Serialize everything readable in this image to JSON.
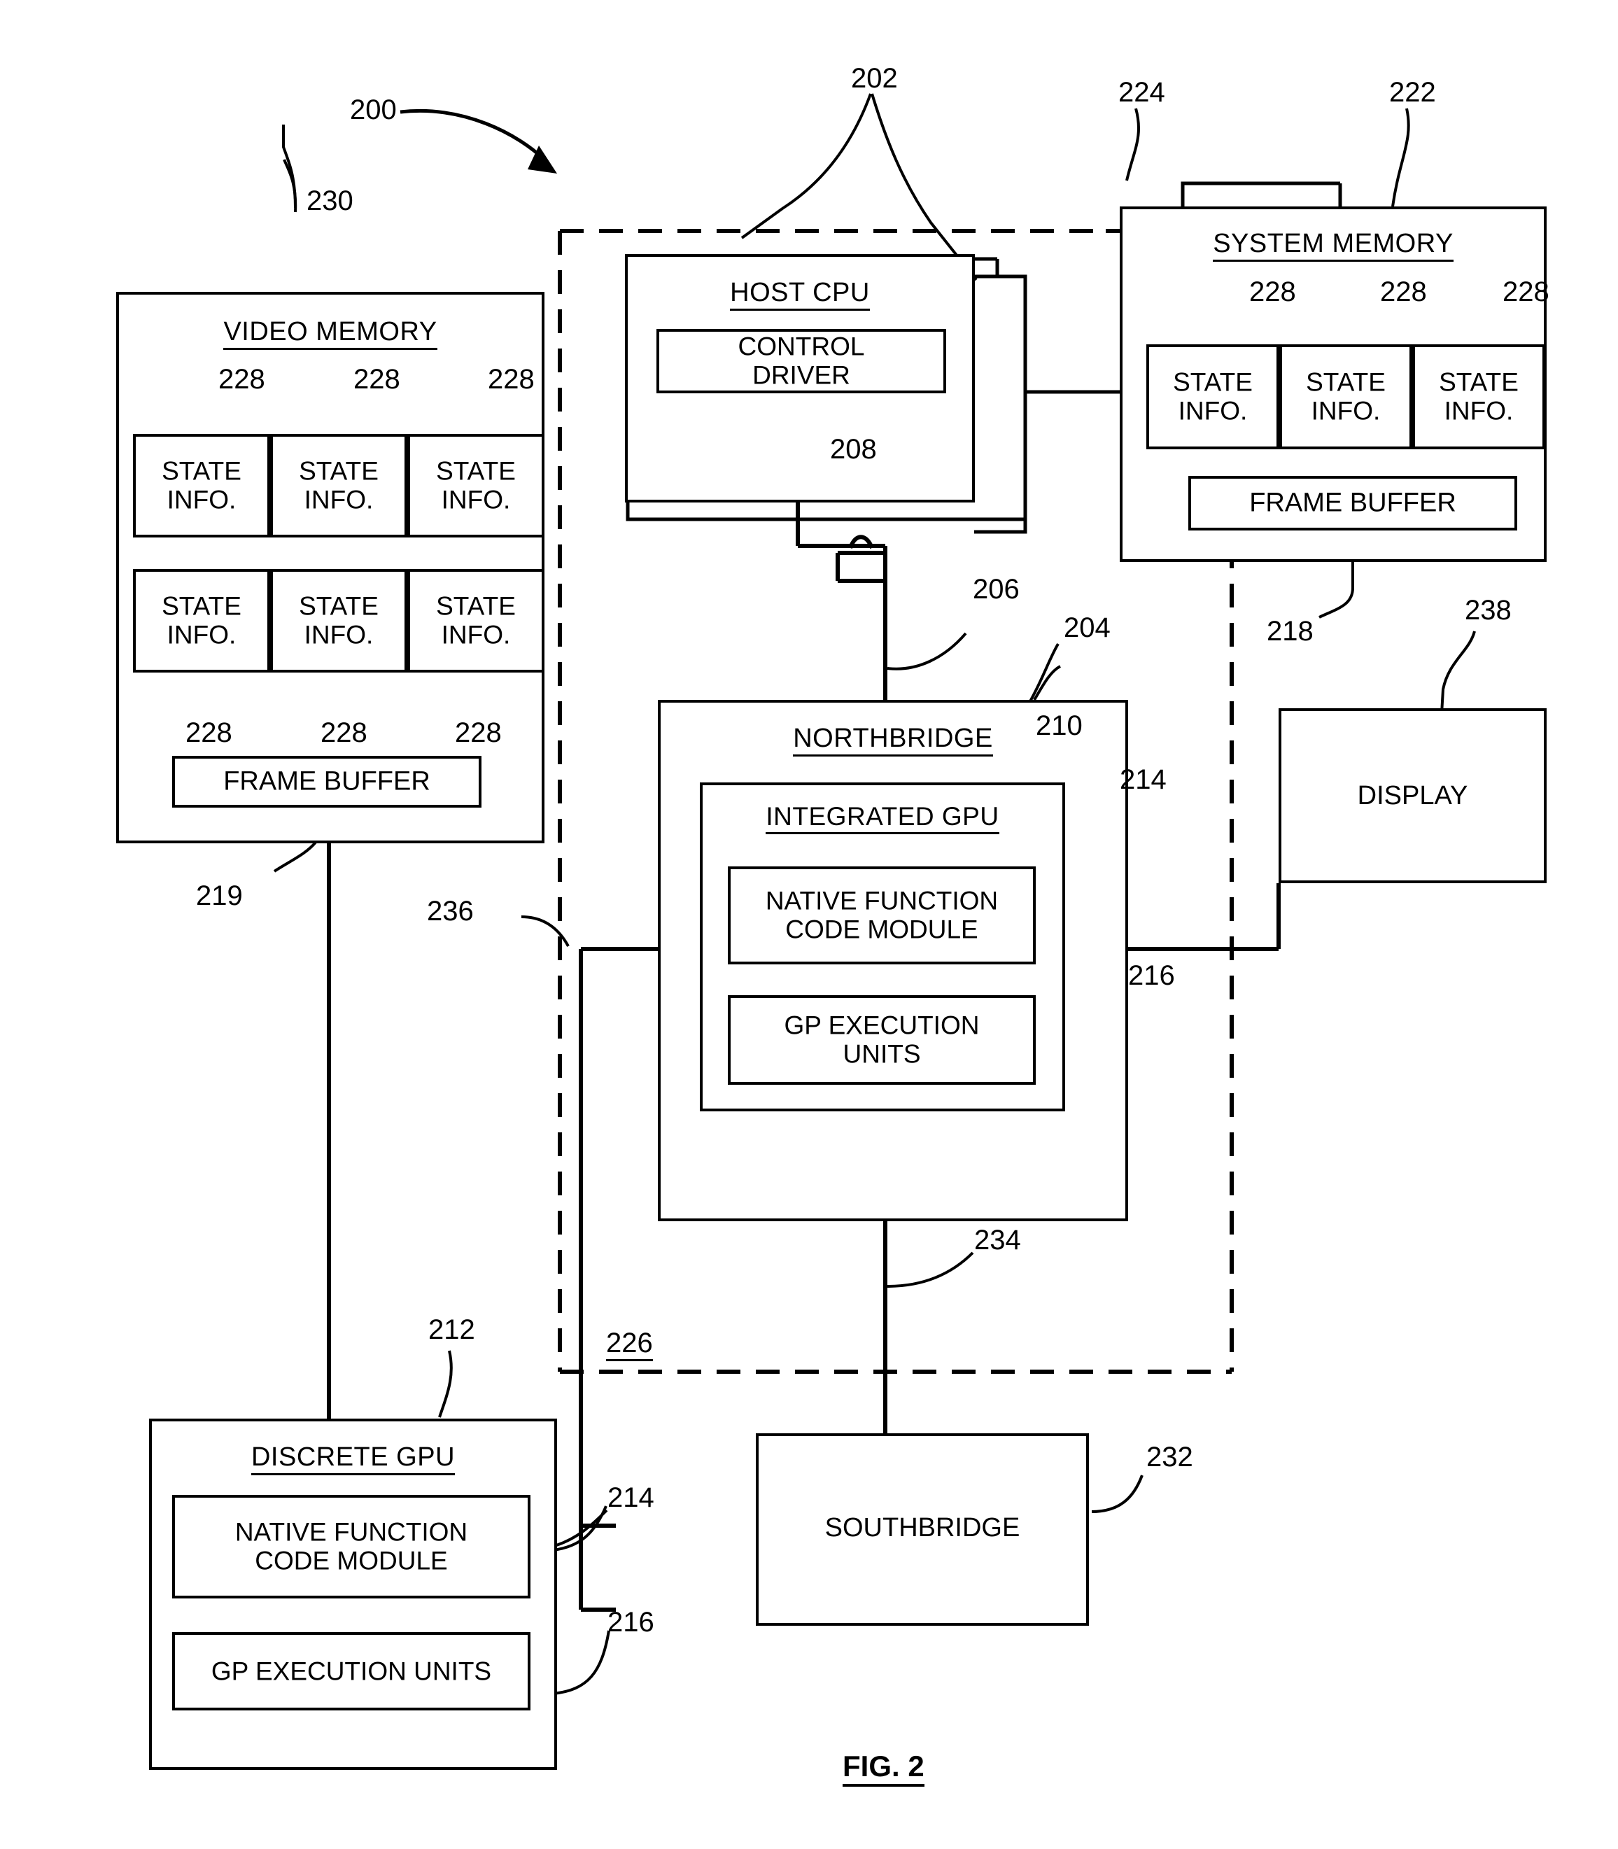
{
  "figure": {
    "label": "FIG. 2",
    "system_ref": "200"
  },
  "blocks": {
    "video_memory": {
      "title": "VIDEO MEMORY",
      "ref": "230",
      "state_cells": [
        {
          "line1": "STATE",
          "line2": "INFO.",
          "ref": "228"
        },
        {
          "line1": "STATE",
          "line2": "INFO.",
          "ref": "228"
        },
        {
          "line1": "STATE",
          "line2": "INFO.",
          "ref": "228"
        },
        {
          "line1": "STATE",
          "line2": "INFO.",
          "ref": "228"
        },
        {
          "line1": "STATE",
          "line2": "INFO.",
          "ref": "228"
        },
        {
          "line1": "STATE",
          "line2": "INFO.",
          "ref": "228"
        }
      ],
      "frame_buffer": {
        "label": "FRAME BUFFER",
        "ref": "219"
      }
    },
    "host_cpu": {
      "title": "HOST CPU",
      "ref": "202",
      "control_driver": {
        "line1": "CONTROL",
        "line2": "DRIVER",
        "ref": "208"
      }
    },
    "system_memory": {
      "title": "SYSTEM MEMORY",
      "ref": "222",
      "bus_ref": "224",
      "state_cells": [
        {
          "line1": "STATE",
          "line2": "INFO.",
          "ref": "228"
        },
        {
          "line1": "STATE",
          "line2": "INFO.",
          "ref": "228"
        },
        {
          "line1": "STATE",
          "line2": "INFO.",
          "ref": "228"
        }
      ],
      "frame_buffer": {
        "label": "FRAME BUFFER",
        "ref": "218"
      }
    },
    "northbridge": {
      "title": "NORTHBRIDGE",
      "ref": "204",
      "link_ref": "206",
      "integrated_gpu": {
        "title": "INTEGRATED GPU",
        "ref": "210",
        "native_function_code_module": {
          "line1": "NATIVE FUNCTION",
          "line2": "CODE MODULE",
          "ref": "214"
        },
        "gp_execution_units": {
          "line1": "GP EXECUTION",
          "line2": "UNITS",
          "ref": "216"
        }
      }
    },
    "display": {
      "title": "DISPLAY",
      "ref": "238"
    },
    "discrete_gpu": {
      "title": "DISCRETE GPU",
      "ref": "212",
      "native_function_code_module": {
        "line1": "NATIVE FUNCTION",
        "line2": "CODE MODULE",
        "ref": "214"
      },
      "gp_execution_units": {
        "label": "GP EXECUTION UNITS",
        "ref": "216"
      }
    },
    "southbridge": {
      "title": "SOUTHBRIDGE",
      "ref": "232",
      "link_ref": "234"
    },
    "boundary": {
      "dashed_ref": "226",
      "bus_ref": "236"
    }
  }
}
